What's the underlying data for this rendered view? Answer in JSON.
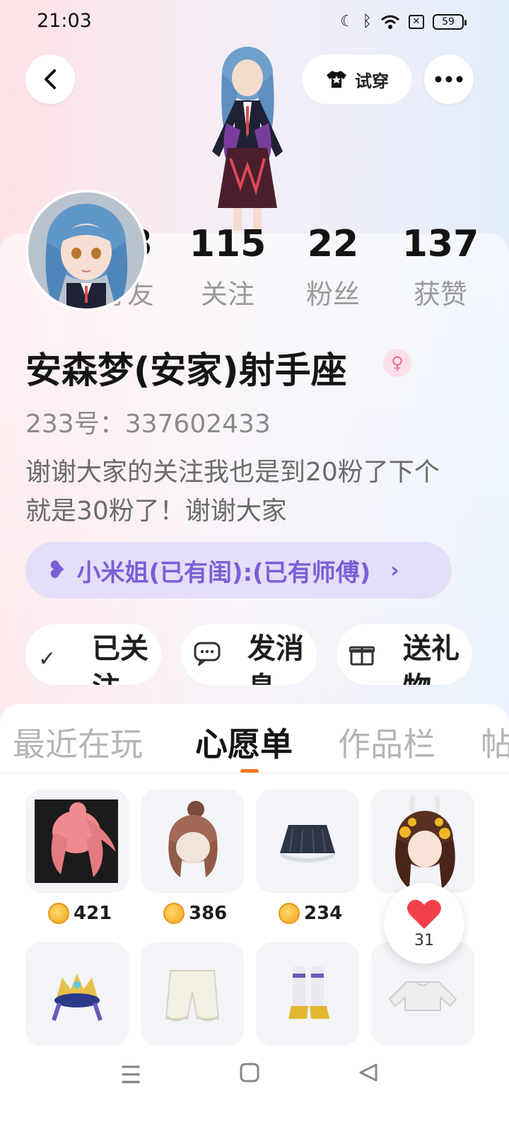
{
  "status_bar": {
    "time": "21:03",
    "battery": "59"
  },
  "header": {
    "try_on_label": "试穿"
  },
  "profile": {
    "stats": [
      {
        "value": "33",
        "label": "好友"
      },
      {
        "value": "115",
        "label": "关注"
      },
      {
        "value": "22",
        "label": "粉丝"
      },
      {
        "value": "137",
        "label": "获赞"
      }
    ],
    "name": "安森梦(安家)射手座",
    "uid": "233号：337602433",
    "bio": "谢谢大家的关注我也是到20粉了下个就是30粉了！谢谢大家",
    "relation_tag": "小米姐(已有闺):(已有师傅)",
    "colors": {
      "relation_bg": "#e4def8",
      "relation_text": "#7b5fd6",
      "accent": "#f27a1a"
    }
  },
  "actions": [
    {
      "icon": "check-icon",
      "label": "已关注"
    },
    {
      "icon": "message-icon",
      "label": "发消息"
    },
    {
      "icon": "gift-icon",
      "label": "送礼物"
    }
  ],
  "tabs": [
    {
      "label": "最近在玩"
    },
    {
      "label": "心愿单"
    },
    {
      "label": "作品栏"
    },
    {
      "label": "帖"
    }
  ],
  "wishlist": {
    "items": [
      {
        "icon": "pink-hair-icon",
        "price": "421"
      },
      {
        "icon": "brown-hair-icon",
        "price": "386"
      },
      {
        "icon": "skirt-icon",
        "price": "234"
      },
      {
        "icon": "flower-hair-icon",
        "price": ""
      },
      {
        "icon": "crown-icon",
        "price": ""
      },
      {
        "icon": "shorts-icon",
        "price": ""
      },
      {
        "icon": "boots-icon",
        "price": ""
      },
      {
        "icon": "crop-top-icon",
        "price": ""
      }
    ],
    "like_count": "31"
  }
}
